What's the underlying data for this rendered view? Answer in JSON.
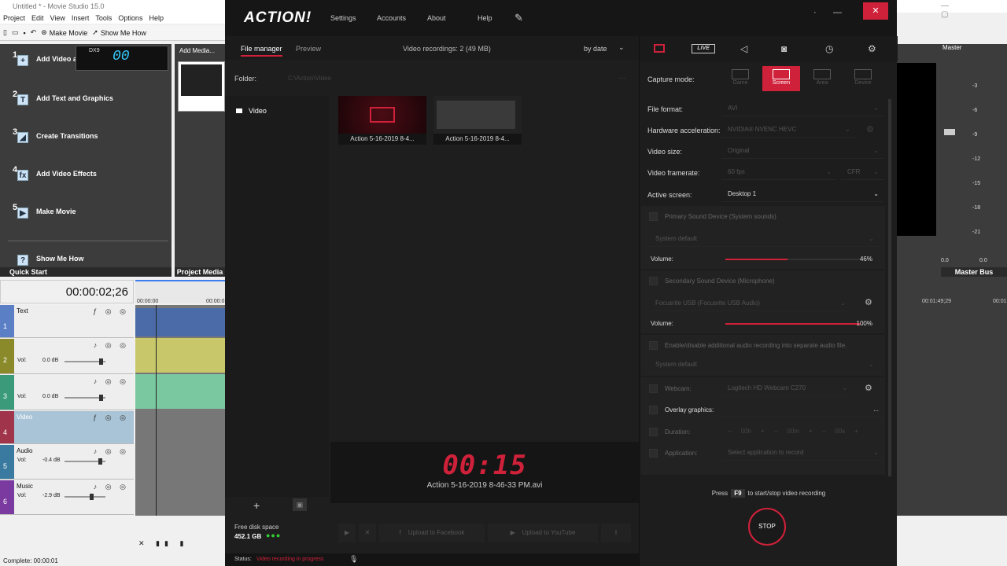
{
  "ms": {
    "title": "Untitled * - Movie Studio 15.0",
    "menu": [
      "Project",
      "Edit",
      "View",
      "Insert",
      "Tools",
      "Options",
      "Help"
    ],
    "toolbar": {
      "make_movie": "Make Movie",
      "show_me_how": "Show Me How"
    },
    "overlay": {
      "api": "DX9",
      "fps_top": "00",
      "fps_small": "00"
    },
    "quick_start": {
      "items": [
        {
          "num": "1",
          "label": "Add Video and Music"
        },
        {
          "num": "2",
          "label": "Add Text and Graphics"
        },
        {
          "num": "3",
          "label": "Create Transitions"
        },
        {
          "num": "4",
          "label": "Add Video Effects"
        },
        {
          "num": "5",
          "label": "Make Movie"
        }
      ],
      "show_me_how": "Show Me How",
      "tab": "Quick Start"
    },
    "project_media": {
      "add_media": "Add Media...",
      "tab": "Project Media"
    },
    "timecode": "00:00:02;26",
    "ruler": [
      "00:00:00",
      "00:00:0"
    ],
    "tracks": [
      {
        "num": "1",
        "name": "Text",
        "vol": "",
        "val": "",
        "color": "#5b7fc4"
      },
      {
        "num": "2",
        "name": "",
        "vol": "Vol:",
        "val": "0.0 dB",
        "color": "#8a8a2a"
      },
      {
        "num": "3",
        "name": "",
        "vol": "Vol:",
        "val": "0.0 dB",
        "color": "#3a9a7a"
      },
      {
        "num": "4",
        "name": "Video",
        "vol": "",
        "val": "",
        "color": "#a0344a"
      },
      {
        "num": "5",
        "name": "Audio",
        "vol": "Vol:",
        "val": "-0.4 dB",
        "color": "#3a7aa0"
      },
      {
        "num": "6",
        "name": "Music",
        "vol": "Vol:",
        "val": "-2.9 dB",
        "color": "#7a3aa0"
      }
    ],
    "status": "Complete: 00:00:01",
    "master": "Master",
    "master_bus": "Master Bus",
    "meter_scale": [
      "-3",
      "-6",
      "-9",
      "-12",
      "-15",
      "-18",
      "-21"
    ],
    "meter_vals": [
      "0.0",
      "0.0"
    ],
    "tl_ruler": [
      "00:01:49;29",
      "00:01"
    ]
  },
  "action": {
    "logo": "ACTION!",
    "nav": [
      "Settings",
      "Accounts",
      "About",
      "Help"
    ],
    "tabs": {
      "file_manager": "File manager",
      "preview": "Preview"
    },
    "recordings": "Video recordings: 2 (49 MB)",
    "sort": "by date",
    "folder_label": "Folder:",
    "folder_path": "C:\\Action\\Video",
    "sidebar_video": "Video",
    "thumbs": [
      "Action 5-16-2019 8-4...",
      "Action 5-16-2019 8-4..."
    ],
    "timer": "00:15",
    "timer_file": "Action 5-16-2019 8-46-33 PM.avi",
    "free_label": "Free disk space",
    "free_value": "452.1 GB",
    "upload_fb": "Upload to Facebook",
    "upload_yt": "Upload to YouTube",
    "status_label": "Status:",
    "status_value": "Video recording in progress",
    "capture_mode_label": "Capture mode:",
    "modes": [
      "Game",
      "Screen",
      "Area",
      "Device"
    ],
    "fields": [
      {
        "label": "File format:",
        "value": "AVI"
      },
      {
        "label": "Hardware acceleration:",
        "value": "NVIDIA® NVENC HEVC"
      },
      {
        "label": "Video size:",
        "value": "Original"
      },
      {
        "label": "Video framerate:",
        "value": "60 fps",
        "extra": "CFR"
      },
      {
        "label": "Active screen:",
        "value": "Desktop 1"
      }
    ],
    "primary_sound": "Primary Sound Device (System sounds)",
    "primary_device": "System default",
    "volume_label": "Volume:",
    "vol1": 46,
    "vol1_text": "46%",
    "secondary_sound": "Secondary Sound Device (Microphone)",
    "secondary_device": "Focusrite USB (Focusrite USB Audio)",
    "vol2": 100,
    "vol2_text": "100%",
    "separate_audio": "Enable/disable additional audio recording into separate audio file.",
    "separate_device": "System default",
    "webcam_label": "Webcam:",
    "webcam_value": "Logitech HD Webcam C270",
    "overlay_label": "Overlay graphics:",
    "overlay_dots": "...",
    "duration_label": "Duration:",
    "duration": [
      "00h",
      "00m",
      "00s"
    ],
    "application_label": "Application:",
    "application_value": "Select application to record",
    "press": "Press",
    "hotkey": "F9",
    "press_suffix": "to start/stop video recording",
    "stop": "STOP",
    "accent": "#d0213a"
  }
}
